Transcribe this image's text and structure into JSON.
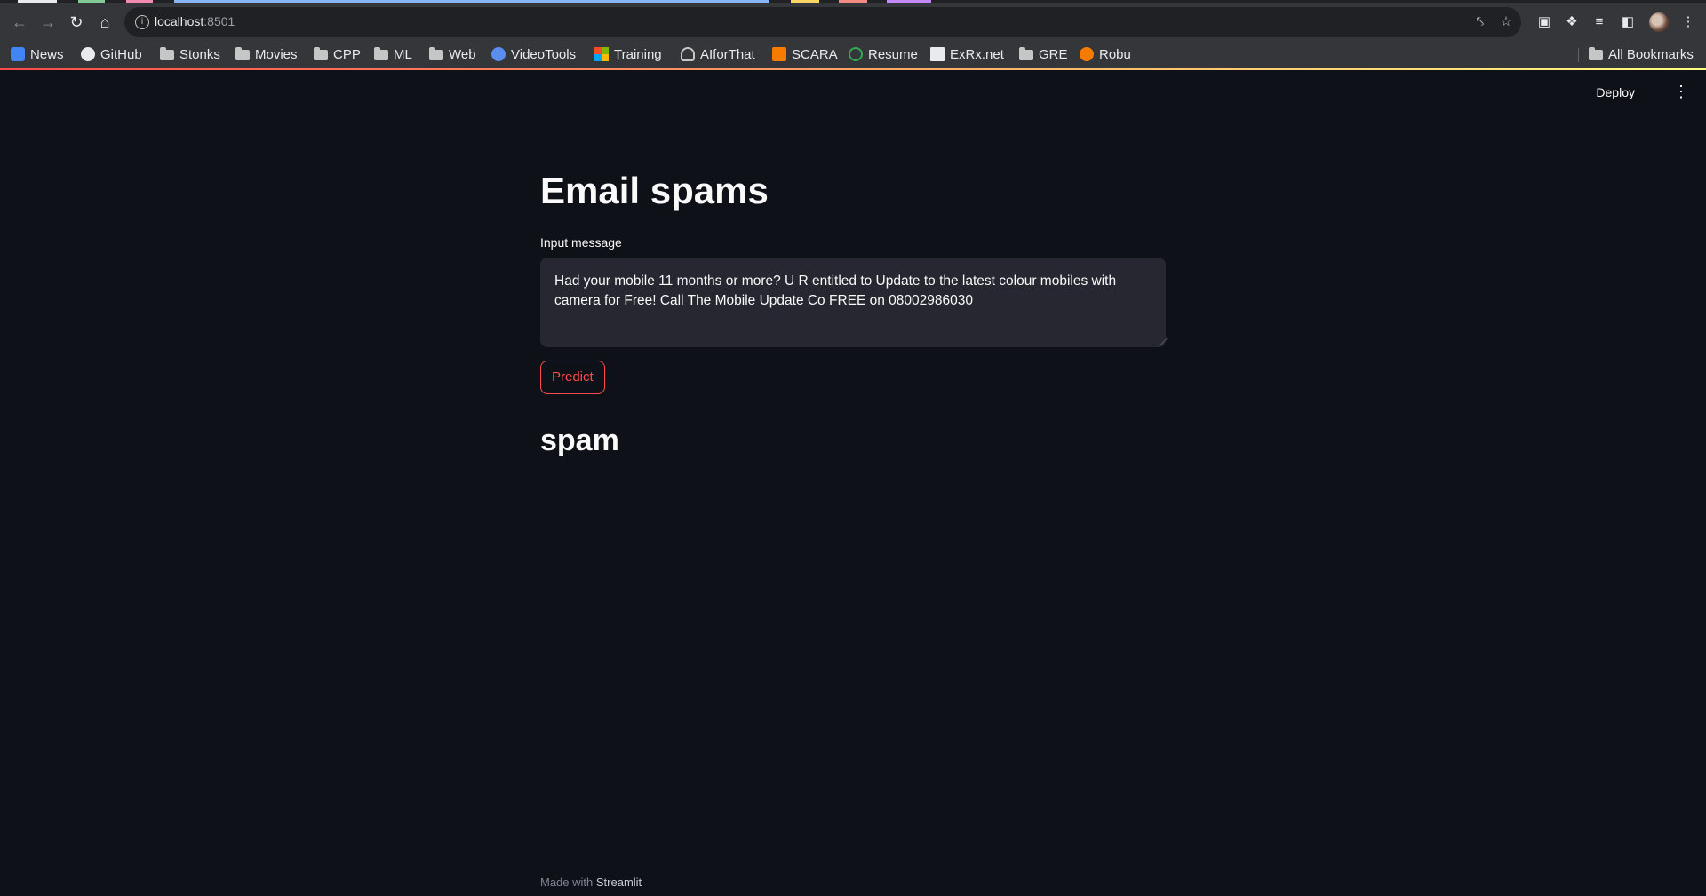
{
  "browser": {
    "url_host": "localhost",
    "url_port": ":8501",
    "bookmarks": [
      {
        "label": "News"
      },
      {
        "label": "GitHub"
      },
      {
        "label": "Stonks"
      },
      {
        "label": "Movies"
      },
      {
        "label": "CPP"
      },
      {
        "label": "ML"
      },
      {
        "label": "Web"
      },
      {
        "label": "VideoTools"
      },
      {
        "label": "Training"
      },
      {
        "label": "AIforThat"
      },
      {
        "label": "SCARA"
      },
      {
        "label": "Resume"
      },
      {
        "label": "ExRx.net"
      },
      {
        "label": "GRE"
      },
      {
        "label": "Robu"
      }
    ],
    "all_bookmarks_label": "All Bookmarks"
  },
  "app": {
    "deploy_label": "Deploy",
    "title": "Email spams",
    "input_label": "Input message",
    "input_value": "Had your mobile 11 months or more? U R entitled to Update to the latest colour mobiles with camera for Free! Call The Mobile Update Co FREE on 08002986030",
    "predict_label": "Predict",
    "result": "spam",
    "footer_prefix": "Made with",
    "footer_brand": "Streamlit"
  },
  "colors": {
    "background": "#0e1117",
    "primary": "#ff4b4b",
    "input_bg": "#262730"
  }
}
